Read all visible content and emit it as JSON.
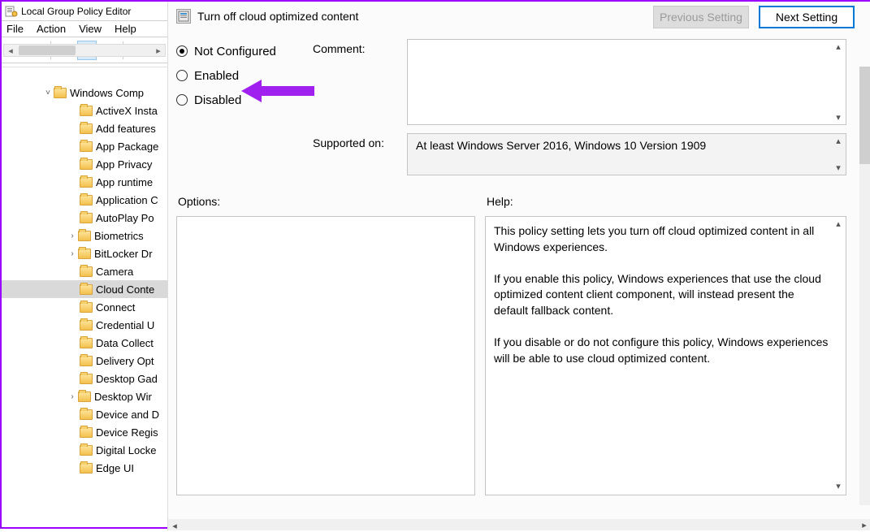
{
  "editor": {
    "title": "Local Group Policy Editor",
    "menus": [
      "File",
      "Action",
      "View",
      "Help"
    ]
  },
  "tree": {
    "root": "Windows Comp",
    "items": [
      {
        "label": "ActiveX Insta",
        "expandable": false
      },
      {
        "label": "Add features",
        "expandable": false
      },
      {
        "label": "App Package",
        "expandable": false
      },
      {
        "label": "App Privacy",
        "expandable": false
      },
      {
        "label": "App runtime",
        "expandable": false
      },
      {
        "label": "Application C",
        "expandable": false
      },
      {
        "label": "AutoPlay Po",
        "expandable": false
      },
      {
        "label": "Biometrics",
        "expandable": true
      },
      {
        "label": "BitLocker Dr",
        "expandable": true
      },
      {
        "label": "Camera",
        "expandable": false
      },
      {
        "label": "Cloud Conte",
        "expandable": false,
        "selected": true
      },
      {
        "label": "Connect",
        "expandable": false
      },
      {
        "label": "Credential U",
        "expandable": false
      },
      {
        "label": "Data Collect",
        "expandable": false
      },
      {
        "label": "Delivery Opt",
        "expandable": false
      },
      {
        "label": "Desktop Gad",
        "expandable": false
      },
      {
        "label": "Desktop Wir",
        "expandable": true
      },
      {
        "label": "Device and D",
        "expandable": false
      },
      {
        "label": "Device Regis",
        "expandable": false
      },
      {
        "label": "Digital Locke",
        "expandable": false
      },
      {
        "label": "Edge UI",
        "expandable": false
      }
    ]
  },
  "dialog": {
    "title": "Turn off cloud optimized content",
    "nav": {
      "prev": "Previous Setting",
      "next": "Next Setting"
    },
    "radios": {
      "not_configured": "Not Configured",
      "enabled": "Enabled",
      "disabled": "Disabled",
      "selected": "not_configured"
    },
    "labels": {
      "comment": "Comment:",
      "supported": "Supported on:",
      "options": "Options:",
      "help": "Help:"
    },
    "supported_text": "At least Windows Server 2016, Windows 10 Version 1909",
    "help_p1": "This policy setting lets you turn off cloud optimized content in all Windows experiences.",
    "help_p2": "If you enable this policy, Windows experiences that use the cloud optimized content client component, will instead present the default fallback content.",
    "help_p3": "If you disable or do not configure this policy, Windows experiences will be able to use cloud optimized content."
  }
}
